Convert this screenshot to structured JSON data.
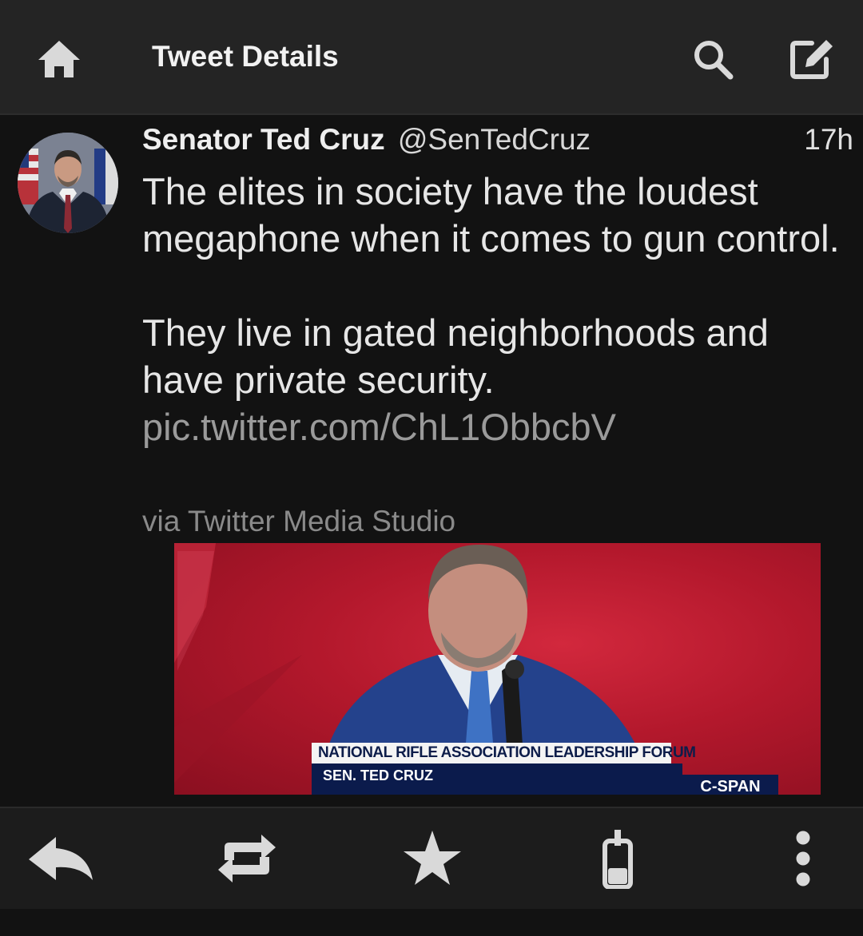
{
  "topbar": {
    "title": "Tweet Details",
    "home_icon": "home-icon",
    "search_icon": "search-icon",
    "compose_icon": "compose-icon"
  },
  "tweet": {
    "author_name": "Senator Ted Cruz",
    "author_handle": "@SenTedCruz",
    "timestamp": "17h",
    "text_paragraph_1": "The elites in society have the loudest megaphone when it comes to gun control.",
    "text_paragraph_2": "They live in gated neighborhoods and have private security.",
    "link": "pic.twitter.com/ChL1ObbcbV",
    "via": "via Twitter Media Studio",
    "media": {
      "lower_third_title": "NATIONAL RIFLE ASSOCIATION LEADERSHIP FORUM",
      "lower_third_name": "SEN. TED CRUZ",
      "network_logo": "C-SPAN"
    }
  },
  "actions": [
    {
      "name": "reply",
      "icon": "reply-icon"
    },
    {
      "name": "retweet",
      "icon": "retweet-icon"
    },
    {
      "name": "favorite",
      "icon": "star-icon"
    },
    {
      "name": "share",
      "icon": "share-icon"
    },
    {
      "name": "more",
      "icon": "more-vertical-icon"
    }
  ],
  "colors": {
    "topbar_bg": "#242424",
    "background": "#121212",
    "actionbar_bg": "#1c1c1c",
    "link": "#9a9a9a",
    "icon": "#d9d9d9"
  }
}
